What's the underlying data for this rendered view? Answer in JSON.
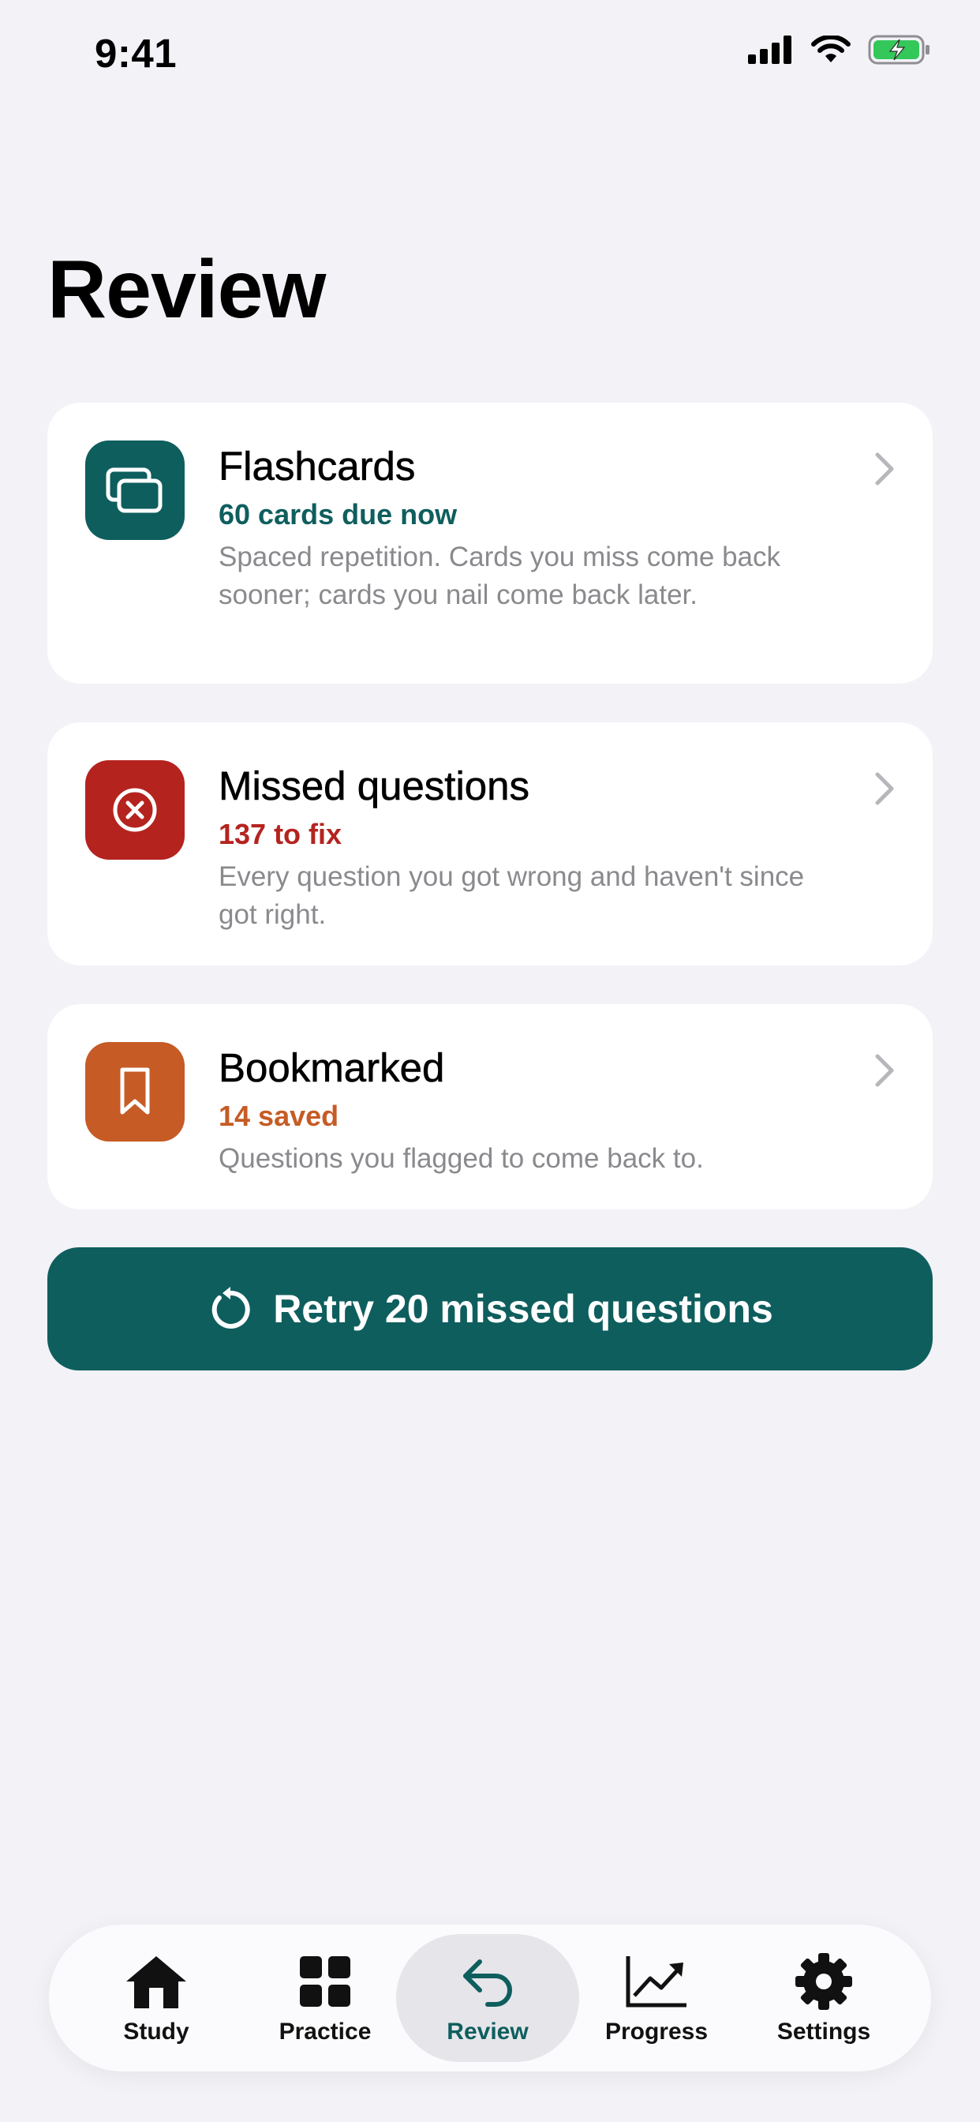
{
  "status_bar": {
    "time": "9:41"
  },
  "page": {
    "title": "Review"
  },
  "cards": [
    {
      "title": "Flashcards",
      "subtitle": "60 cards due now",
      "description": "Spaced repetition. Cards you miss come back sooner; cards you nail come back later.",
      "icon": "flashcards-icon",
      "color": "#0f5e5e"
    },
    {
      "title": "Missed questions",
      "subtitle": "137 to fix",
      "description": "Every question you got wrong and haven't since got right.",
      "icon": "x-circle-icon",
      "color": "#b5231f"
    },
    {
      "title": "Bookmarked",
      "subtitle": "14 saved",
      "description": "Questions you flagged to come back to.",
      "icon": "bookmark-icon",
      "color": "#c65b25"
    }
  ],
  "retry_button": {
    "label": "Retry 20 missed questions",
    "icon": "retry-icon"
  },
  "tab_bar": {
    "active": "Review",
    "tabs": [
      {
        "label": "Study",
        "icon": "home-icon"
      },
      {
        "label": "Practice",
        "icon": "grid-icon"
      },
      {
        "label": "Review",
        "icon": "return-arrow-icon"
      },
      {
        "label": "Progress",
        "icon": "trend-chart-icon"
      },
      {
        "label": "Settings",
        "icon": "gear-icon"
      }
    ]
  },
  "colors": {
    "accent": "#0f5e5e",
    "background": "#f2f2f7",
    "battery": "#34c759"
  }
}
